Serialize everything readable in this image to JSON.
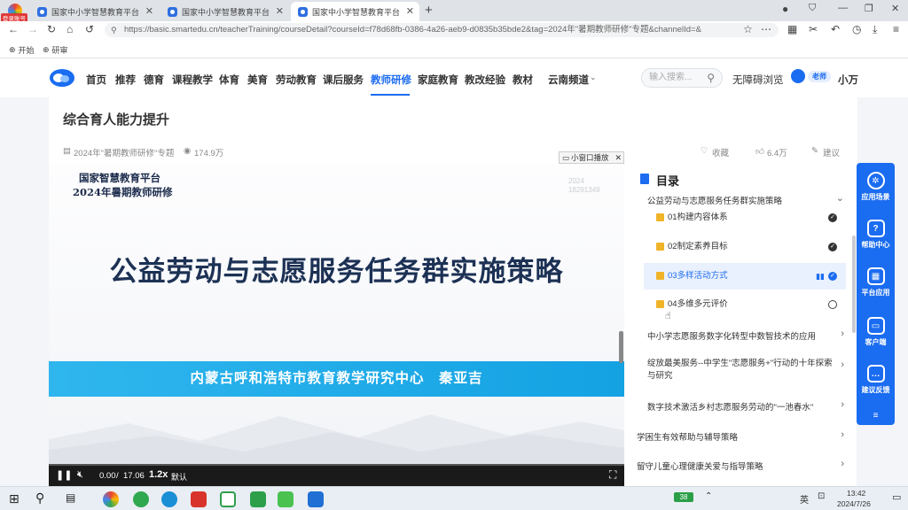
{
  "corner_badge": "登录账号",
  "tabs": [
    {
      "title": "国家中小学智慧教育平台"
    },
    {
      "title": "国家中小学智慧教育平台"
    },
    {
      "title": "国家中小学智慧教育平台"
    }
  ],
  "address_bar": {
    "url": "https://basic.smartedu.cn/teacherTraining/courseDetail?courseId=f78d68fb-0386-4a26-aeb9-d0835b35bde2&tag=2024年\"暑期教师研修\"专题&channelId=&"
  },
  "bookmarks": [
    "开始",
    "研审"
  ],
  "site_nav": {
    "items": [
      "首页",
      "推荐",
      "德育",
      "课程教学",
      "体育",
      "美育",
      "劳动教育",
      "课后服务",
      "教师研修",
      "家庭教育",
      "教改经验",
      "教材",
      "云南频道"
    ],
    "active": "教师研修",
    "search_placeholder": "输入搜索...",
    "accessibility": "无障碍浏览",
    "role_badge": "老师",
    "username": "小万"
  },
  "course": {
    "title": "综合育人能力提升",
    "topic": "2024年\"暑期教师研修\"专题",
    "views": "174.9万",
    "favorite": "收藏",
    "likes": "6.4万",
    "suggest": "建议"
  },
  "video": {
    "popout_label": "小窗口播放",
    "slide_header_line1": "国家智慧教育平台",
    "slide_header_line2": "2024年暑期教师研修",
    "slide_title": "公益劳动与志愿服务任务群实施策略",
    "slide_speaker": "内蒙古呼和浩特市教育教学研究中心　秦亚吉",
    "watermark": "2024 18291349",
    "current_time": "0.00",
    "duration": "17.06",
    "speed": "1.2x",
    "quality": "默认",
    "progress": 0.0
  },
  "catalog": {
    "title": "目录",
    "section_title": "公益劳动与志愿服务任务群实施策略",
    "lessons": [
      {
        "label": "01构建内容体系",
        "status": "done"
      },
      {
        "label": "02制定素养目标",
        "status": "done"
      },
      {
        "label": "03多样活动方式",
        "status": "playing"
      },
      {
        "label": "04多维多元评价",
        "status": "todo"
      }
    ],
    "sections": [
      "中小学志愿服务数字化转型中数智技术的应用",
      "绽放最美服务--中学生\"志愿服务+\"行动的十年探索与研究",
      "数字技术激活乡村志愿服务劳动的\"一池春水\""
    ],
    "chapters": [
      "学困生有效帮助与辅导策略",
      "留守儿童心理健康关爱与指导策略"
    ]
  },
  "side_panel": [
    "应用场景",
    "帮助中心",
    "平台应用",
    "客户端",
    "建议反馈"
  ],
  "taskbar": {
    "lang": "英",
    "time": "13:42",
    "date": "2024/7/26",
    "battery_label": "38"
  }
}
